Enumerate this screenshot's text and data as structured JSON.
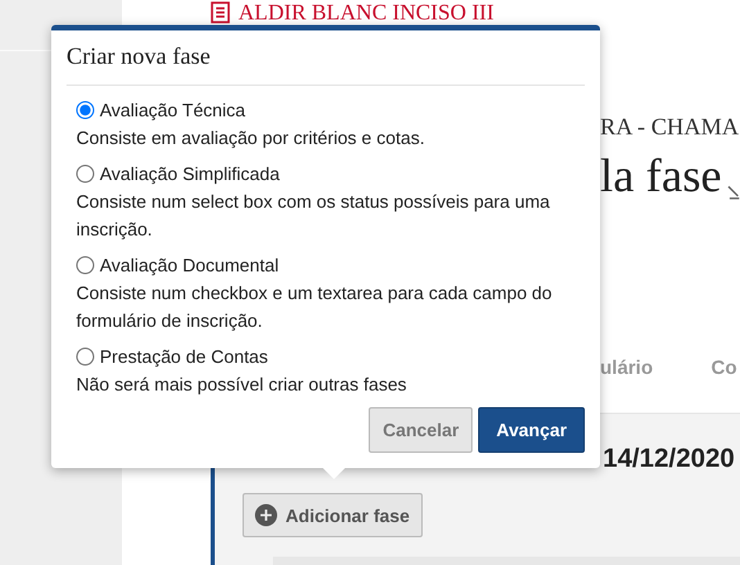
{
  "page": {
    "program_title": "ALDIR BLANC INCISO III",
    "subtitle": "RA - CHAMA",
    "heading": "la fase",
    "tabs": [
      {
        "label": "ulário"
      },
      {
        "label": "Co"
      }
    ],
    "period_text": "14/12/2020",
    "add_button": "Adicionar fase"
  },
  "dialog": {
    "title": "Criar nova fase",
    "options": [
      {
        "label": "Avaliação Técnica",
        "description": "Consiste em avaliação por critérios e cotas.",
        "selected": true
      },
      {
        "label": "Avaliação Simplificada",
        "description": "Consiste num select box com os status possíveis para uma inscrição.",
        "selected": false
      },
      {
        "label": "Avaliação Documental",
        "description": "Consiste num checkbox e um textarea para cada campo do formulário de inscrição.",
        "selected": false
      },
      {
        "label": "Prestação de Contas",
        "description": "Não será mais possível criar outras fases",
        "selected": false
      }
    ],
    "buttons": [
      {
        "label": "Cancelar",
        "kind": "secondary"
      },
      {
        "label": "Avançar",
        "kind": "primary"
      }
    ]
  }
}
